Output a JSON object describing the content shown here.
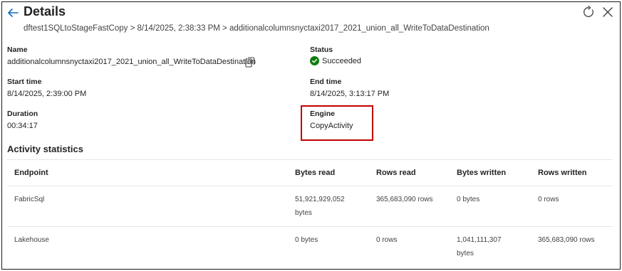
{
  "header": {
    "title": "Details",
    "breadcrumb": "dftest1SQLtoStageFastCopy > 8/14/2025, 2:38:33 PM > additionalcolumnsnyctaxi2017_2021_union_all_WriteToDataDestination"
  },
  "details": {
    "name_label": "Name",
    "name_value": "additionalcolumnsnyctaxi2017_2021_union_all_WriteToDataDestination",
    "status_label": "Status",
    "status_value": "Succeeded",
    "start_label": "Start time",
    "start_value": "8/14/2025, 2:39:00 PM",
    "end_label": "End time",
    "end_value": "8/14/2025, 3:13:17 PM",
    "duration_label": "Duration",
    "duration_value": "00:34:17",
    "engine_label": "Engine",
    "engine_value": "CopyActivity"
  },
  "stats": {
    "title": "Activity statistics",
    "columns": [
      "Endpoint",
      "Bytes read",
      "Rows read",
      "Bytes written",
      "Rows written"
    ],
    "rows": [
      {
        "endpoint": "FabricSql",
        "bytes_read_line1": "51,921,929,052",
        "bytes_read_line2": "bytes",
        "rows_read": "365,683,090 rows",
        "bytes_written_line1": "0 bytes",
        "bytes_written_line2": "",
        "rows_written": "0 rows"
      },
      {
        "endpoint": "Lakehouse",
        "bytes_read_line1": "0 bytes",
        "bytes_read_line2": "",
        "rows_read": "0 rows",
        "bytes_written_line1": "1,041,111,307",
        "bytes_written_line2": "bytes",
        "rows_written": "365,683,090 rows"
      }
    ]
  },
  "colors": {
    "accent": "#0f6cbd",
    "success": "#107c10",
    "highlight": "#c00000"
  },
  "icons": {
    "back": "arrow-left-icon",
    "refresh": "refresh-icon",
    "close": "close-icon",
    "copy": "copy-icon",
    "status": "check-circle-icon"
  }
}
